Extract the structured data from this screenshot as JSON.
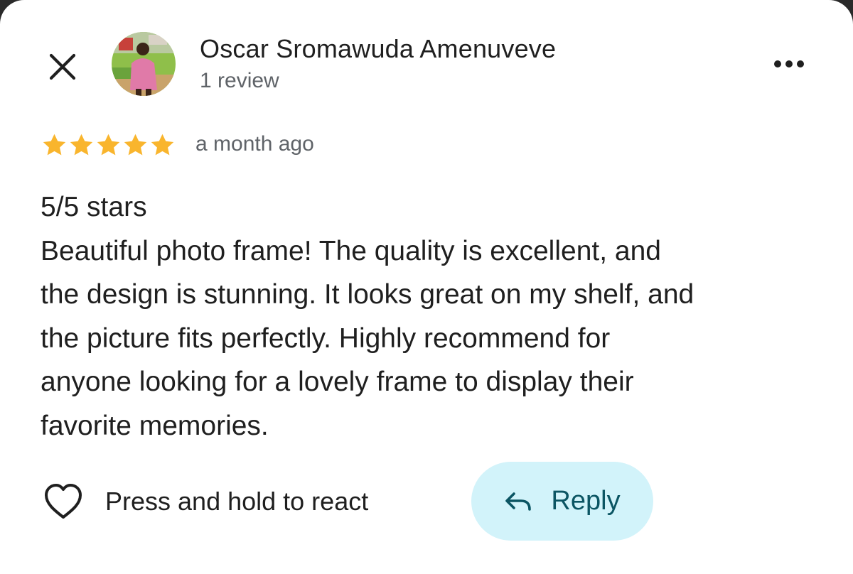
{
  "reviewer": {
    "name": "Oscar Sromawuda Amenuveve",
    "review_count": "1 review"
  },
  "review": {
    "rating": 5,
    "max_rating": 5,
    "time": "a month ago",
    "body_lines": [
      "5/5 stars",
      "Beautiful photo frame! The quality is excellent, and",
      "the design is stunning. It looks great on my shelf, and",
      "the picture fits perfectly. Highly recommend for",
      "anyone looking for a lovely frame to display their",
      "favorite memories."
    ]
  },
  "actions": {
    "react_label": "Press and hold to react",
    "reply_label": "Reply"
  },
  "icons": {
    "close": "close-icon",
    "more": "more-horizontal-icon",
    "star": "star-icon",
    "heart": "heart-outline-icon",
    "reply": "reply-arrow-icon"
  },
  "colors": {
    "star": "#f9b52d",
    "reply_background": "#d2f3fa",
    "reply_text": "#0b5563",
    "secondary_text": "#5f6368",
    "primary_text": "#1f1f1f"
  }
}
